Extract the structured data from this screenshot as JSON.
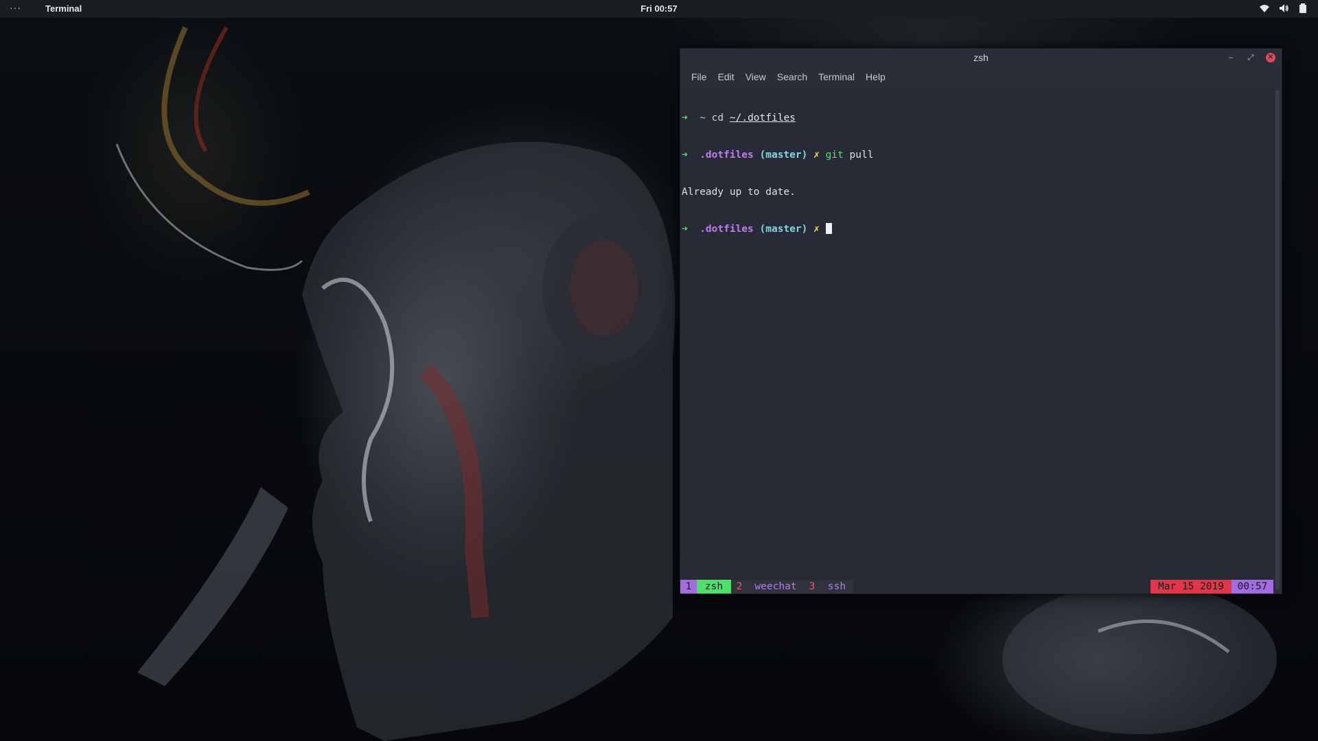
{
  "topbar": {
    "activities": "···",
    "app_name": "Terminal",
    "clock": "Fri 00:57",
    "tray_icons": [
      "wifi-icon",
      "volume-icon",
      "battery-icon"
    ]
  },
  "window": {
    "title": "zsh",
    "buttons": [
      "minimize-icon",
      "maximize-icon",
      "close-icon"
    ],
    "menu": [
      "File",
      "Edit",
      "View",
      "Search",
      "Terminal",
      "Help"
    ]
  },
  "terminal": {
    "lines": [
      {
        "arrow": "➜",
        "dir": "~",
        "cmd": "cd",
        "arg": "~/.dotfiles"
      },
      {
        "arrow": "➜",
        "dir": ".dotfiles",
        "branch": "(master)",
        "dirty": "✗",
        "cmd": "git",
        "arg": "pull"
      },
      {
        "output": "Already up to date."
      },
      {
        "arrow": "➜",
        "dir": ".dotfiles",
        "branch": "(master)",
        "dirty": "✗"
      }
    ]
  },
  "tmux": {
    "windows": [
      {
        "index": "1",
        "name": "zsh",
        "active": true
      },
      {
        "index": "2",
        "name": "weechat",
        "active": false
      },
      {
        "index": "3",
        "name": "ssh",
        "active": false
      }
    ],
    "date": "Mar 15 2019",
    "time": "00:57"
  },
  "colors": {
    "terminal_bg": "#282b36",
    "prompt_arrow": "#50e070",
    "dir": "#c07cf0",
    "branch": "#7fd8e6",
    "dirty": "#f0e060",
    "active_window": "#4ee06a",
    "date_bg": "#e0364a",
    "time_bg": "#a46ae0"
  }
}
